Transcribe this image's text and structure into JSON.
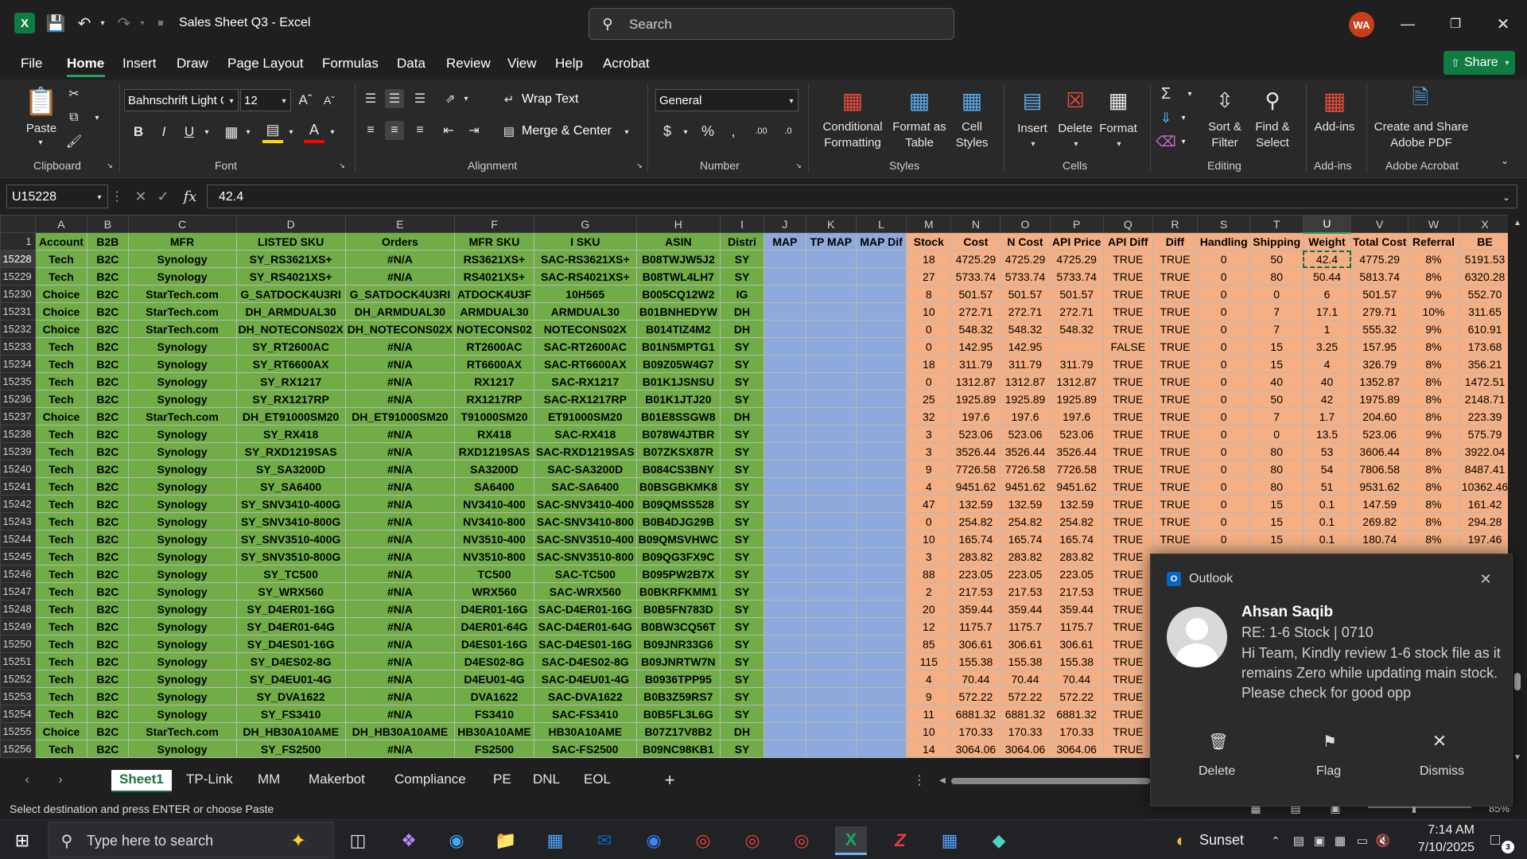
{
  "app": {
    "title": "Sales Sheet Q3 - Excel",
    "search_placeholder": "Search",
    "avatar": "WA",
    "share": "Share"
  },
  "menu": [
    "File",
    "Home",
    "Insert",
    "Draw",
    "Page Layout",
    "Formulas",
    "Data",
    "Review",
    "View",
    "Help",
    "Acrobat"
  ],
  "ribbon": {
    "paste": "Paste",
    "clipboard": "Clipboard",
    "font_name": "Bahnschrift Light C",
    "font_size": "12",
    "font": "Font",
    "wrap": "Wrap Text",
    "merge": "Merge & Center",
    "alignment": "Alignment",
    "number_format": "General",
    "number": "Number",
    "cond1": "Conditional",
    "cond2": "Formatting",
    "fat1": "Format as",
    "fat2": "Table",
    "cs1": "Cell",
    "cs2": "Styles",
    "styles": "Styles",
    "insert": "Insert",
    "delete": "Delete",
    "format": "Format",
    "cells": "Cells",
    "sort1": "Sort &",
    "sort2": "Filter",
    "find1": "Find &",
    "find2": "Select",
    "editing": "Editing",
    "addins": "Add-ins",
    "addins_grp": "Add-ins",
    "acro1": "Create and Share",
    "acro2": "Adobe PDF",
    "acrobat_grp": "Adobe Acrobat"
  },
  "formula_bar": {
    "name_box": "U15228",
    "value": "42.4"
  },
  "columns": [
    "A",
    "B",
    "C",
    "D",
    "E",
    "F",
    "G",
    "H",
    "I",
    "J",
    "K",
    "L",
    "M",
    "N",
    "O",
    "P",
    "Q",
    "R",
    "S",
    "T",
    "U",
    "V",
    "W",
    "X",
    "M"
  ],
  "header_row": {
    "num": "1",
    "cells": [
      "Account",
      "B2B",
      "MFR",
      "LISTED SKU",
      "Orders",
      "MFR SKU",
      "I SKU",
      "ASIN",
      "Distri",
      "MAP",
      "TP MAP",
      "MAP Dif",
      "Stock",
      "Cost",
      "N Cost",
      "API Price",
      "API Diff",
      "Diff",
      "Handling",
      "Shipping",
      "Weight",
      "Total Cost",
      "Referral",
      "BE",
      ""
    ]
  },
  "rows": [
    [
      "15228",
      "Tech",
      "B2C",
      "Synology",
      "SY_RS3621XS+",
      "#N/A",
      "RS3621XS+",
      "SAC-RS3621XS+",
      "B08TWJW5J2",
      "SY",
      "",
      "",
      "",
      "18",
      "4725.29",
      "4725.29",
      "4725.29",
      "TRUE",
      "TRUE",
      "0",
      "50",
      "42.4",
      "4775.29",
      "8%",
      "5191.53",
      ""
    ],
    [
      "15229",
      "Tech",
      "B2C",
      "Synology",
      "SY_RS4021XS+",
      "#N/A",
      "RS4021XS+",
      "SAC-RS4021XS+",
      "B08TWL4LH7",
      "SY",
      "",
      "",
      "",
      "27",
      "5733.74",
      "5733.74",
      "5733.74",
      "TRUE",
      "TRUE",
      "0",
      "80",
      "50.44",
      "5813.74",
      "8%",
      "6320.28",
      ""
    ],
    [
      "15230",
      "Choice",
      "B2C",
      "StarTech.com",
      "G_SATDOCK4U3RI",
      "G_SATDOCK4U3RI",
      "ATDOCK4U3F",
      "10H565",
      "B005CQ12W2",
      "IG",
      "",
      "",
      "",
      "8",
      "501.57",
      "501.57",
      "501.57",
      "TRUE",
      "TRUE",
      "0",
      "0",
      "6",
      "501.57",
      "9%",
      "552.70",
      ""
    ],
    [
      "15231",
      "Choice",
      "B2C",
      "StarTech.com",
      "DH_ARMDUAL30",
      "DH_ARMDUAL30",
      "ARMDUAL30",
      "ARMDUAL30",
      "B01BNHEDYW",
      "DH",
      "",
      "",
      "",
      "10",
      "272.71",
      "272.71",
      "272.71",
      "TRUE",
      "TRUE",
      "0",
      "7",
      "17.1",
      "279.71",
      "10%",
      "311.65",
      ""
    ],
    [
      "15232",
      "Choice",
      "B2C",
      "StarTech.com",
      "DH_NOTECONS02X",
      "DH_NOTECONS02X",
      "NOTECONS02",
      "NOTECONS02X",
      "B014TIZ4M2",
      "DH",
      "",
      "",
      "",
      "0",
      "548.32",
      "548.32",
      "548.32",
      "TRUE",
      "TRUE",
      "0",
      "7",
      "1",
      "555.32",
      "9%",
      "610.91",
      ""
    ],
    [
      "15233",
      "Tech",
      "B2C",
      "Synology",
      "SY_RT2600AC",
      "#N/A",
      "RT2600AC",
      "SAC-RT2600AC",
      "B01N5MPTG1",
      "SY",
      "",
      "",
      "",
      "0",
      "142.95",
      "142.95",
      "",
      "FALSE",
      "TRUE",
      "0",
      "15",
      "3.25",
      "157.95",
      "8%",
      "173.68",
      ""
    ],
    [
      "15234",
      "Tech",
      "B2C",
      "Synology",
      "SY_RT6600AX",
      "#N/A",
      "RT6600AX",
      "SAC-RT6600AX",
      "B09Z05W4G7",
      "SY",
      "",
      "",
      "",
      "18",
      "311.79",
      "311.79",
      "311.79",
      "TRUE",
      "TRUE",
      "0",
      "15",
      "4",
      "326.79",
      "8%",
      "356.21",
      ""
    ],
    [
      "15235",
      "Tech",
      "B2C",
      "Synology",
      "SY_RX1217",
      "#N/A",
      "RX1217",
      "SAC-RX1217",
      "B01K1JSNSU",
      "SY",
      "",
      "",
      "",
      "0",
      "1312.87",
      "1312.87",
      "1312.87",
      "TRUE",
      "TRUE",
      "0",
      "40",
      "40",
      "1352.87",
      "8%",
      "1472.51",
      ""
    ],
    [
      "15236",
      "Tech",
      "B2C",
      "Synology",
      "SY_RX1217RP",
      "#N/A",
      "RX1217RP",
      "SAC-RX1217RP",
      "B01K1JTJ20",
      "SY",
      "",
      "",
      "",
      "25",
      "1925.89",
      "1925.89",
      "1925.89",
      "TRUE",
      "TRUE",
      "0",
      "50",
      "42",
      "1975.89",
      "8%",
      "2148.71",
      ""
    ],
    [
      "15237",
      "Choice",
      "B2C",
      "StarTech.com",
      "DH_ET91000SM20",
      "DH_ET91000SM20",
      "T91000SM20",
      "ET91000SM20",
      "B01E8SSGW8",
      "DH",
      "",
      "",
      "",
      "32",
      "197.6",
      "197.6",
      "197.6",
      "TRUE",
      "TRUE",
      "0",
      "7",
      "1.7",
      "204.60",
      "8%",
      "223.39",
      ""
    ],
    [
      "15238",
      "Tech",
      "B2C",
      "Synology",
      "SY_RX418",
      "#N/A",
      "RX418",
      "SAC-RX418",
      "B078W4JTBR",
      "SY",
      "",
      "",
      "",
      "3",
      "523.06",
      "523.06",
      "523.06",
      "TRUE",
      "TRUE",
      "0",
      "0",
      "13.5",
      "523.06",
      "9%",
      "575.79",
      ""
    ],
    [
      "15239",
      "Tech",
      "B2C",
      "Synology",
      "SY_RXD1219SAS",
      "#N/A",
      "RXD1219SAS",
      "SAC-RXD1219SAS",
      "B07ZKSX87R",
      "SY",
      "",
      "",
      "",
      "3",
      "3526.44",
      "3526.44",
      "3526.44",
      "TRUE",
      "TRUE",
      "0",
      "80",
      "53",
      "3606.44",
      "8%",
      "3922.04",
      ""
    ],
    [
      "15240",
      "Tech",
      "B2C",
      "Synology",
      "SY_SA3200D",
      "#N/A",
      "SA3200D",
      "SAC-SA3200D",
      "B084CS3BNY",
      "SY",
      "",
      "",
      "",
      "9",
      "7726.58",
      "7726.58",
      "7726.58",
      "TRUE",
      "TRUE",
      "0",
      "80",
      "54",
      "7806.58",
      "8%",
      "8487.41",
      ""
    ],
    [
      "15241",
      "Tech",
      "B2C",
      "Synology",
      "SY_SA6400",
      "#N/A",
      "SA6400",
      "SAC-SA6400",
      "B0BSGBKMK8",
      "SY",
      "",
      "",
      "",
      "4",
      "9451.62",
      "9451.62",
      "9451.62",
      "TRUE",
      "TRUE",
      "0",
      "80",
      "51",
      "9531.62",
      "8%",
      "10362.46",
      ""
    ],
    [
      "15242",
      "Tech",
      "B2C",
      "Synology",
      "SY_SNV3410-400G",
      "#N/A",
      "NV3410-400",
      "SAC-SNV3410-400",
      "B09QMSS528",
      "SY",
      "",
      "",
      "",
      "47",
      "132.59",
      "132.59",
      "132.59",
      "TRUE",
      "TRUE",
      "0",
      "15",
      "0.1",
      "147.59",
      "8%",
      "161.42",
      ""
    ],
    [
      "15243",
      "Tech",
      "B2C",
      "Synology",
      "SY_SNV3410-800G",
      "#N/A",
      "NV3410-800",
      "SAC-SNV3410-800",
      "B0B4DJG29B",
      "SY",
      "",
      "",
      "",
      "0",
      "254.82",
      "254.82",
      "254.82",
      "TRUE",
      "TRUE",
      "0",
      "15",
      "0.1",
      "269.82",
      "8%",
      "294.28",
      ""
    ],
    [
      "15244",
      "Tech",
      "B2C",
      "Synology",
      "SY_SNV3510-400G",
      "#N/A",
      "NV3510-400",
      "SAC-SNV3510-400",
      "B09QMSVHWC",
      "SY",
      "",
      "",
      "",
      "10",
      "165.74",
      "165.74",
      "165.74",
      "TRUE",
      "TRUE",
      "0",
      "15",
      "0.1",
      "180.74",
      "8%",
      "197.46",
      ""
    ],
    [
      "15245",
      "Tech",
      "B2C",
      "Synology",
      "SY_SNV3510-800G",
      "#N/A",
      "NV3510-800",
      "SAC-SNV3510-800",
      "B09QG3FX9C",
      "SY",
      "",
      "",
      "",
      "3",
      "283.82",
      "283.82",
      "283.82",
      "TRUE",
      "",
      "",
      "",
      "",
      "",
      "",
      "",
      ""
    ],
    [
      "15246",
      "Tech",
      "B2C",
      "Synology",
      "SY_TC500",
      "#N/A",
      "TC500",
      "SAC-TC500",
      "B095PW2B7X",
      "SY",
      "",
      "",
      "",
      "88",
      "223.05",
      "223.05",
      "223.05",
      "TRUE",
      "",
      "",
      "",
      "",
      "",
      "",
      "",
      ""
    ],
    [
      "15247",
      "Tech",
      "B2C",
      "Synology",
      "SY_WRX560",
      "#N/A",
      "WRX560",
      "SAC-WRX560",
      "B0BKRFKMM1",
      "SY",
      "",
      "",
      "",
      "2",
      "217.53",
      "217.53",
      "217.53",
      "TRUE",
      "",
      "",
      "",
      "",
      "",
      "",
      "",
      ""
    ],
    [
      "15248",
      "Tech",
      "B2C",
      "Synology",
      "SY_D4ER01-16G",
      "#N/A",
      "D4ER01-16G",
      "SAC-D4ER01-16G",
      "B0B5FN783D",
      "SY",
      "",
      "",
      "",
      "20",
      "359.44",
      "359.44",
      "359.44",
      "TRUE",
      "",
      "",
      "",
      "",
      "",
      "",
      "",
      ""
    ],
    [
      "15249",
      "Tech",
      "B2C",
      "Synology",
      "SY_D4ER01-64G",
      "#N/A",
      "D4ER01-64G",
      "SAC-D4ER01-64G",
      "B0BW3CQ56T",
      "SY",
      "",
      "",
      "",
      "12",
      "1175.7",
      "1175.7",
      "1175.7",
      "TRUE",
      "",
      "",
      "",
      "",
      "",
      "",
      "",
      ""
    ],
    [
      "15250",
      "Tech",
      "B2C",
      "Synology",
      "SY_D4ES01-16G",
      "#N/A",
      "D4ES01-16G",
      "SAC-D4ES01-16G",
      "B09JNR33G6",
      "SY",
      "",
      "",
      "",
      "85",
      "306.61",
      "306.61",
      "306.61",
      "TRUE",
      "",
      "",
      "",
      "",
      "",
      "",
      "",
      ""
    ],
    [
      "15251",
      "Tech",
      "B2C",
      "Synology",
      "SY_D4ES02-8G",
      "#N/A",
      "D4ES02-8G",
      "SAC-D4ES02-8G",
      "B09JNRTW7N",
      "SY",
      "",
      "",
      "",
      "115",
      "155.38",
      "155.38",
      "155.38",
      "TRUE",
      "",
      "",
      "",
      "",
      "",
      "",
      "",
      ""
    ],
    [
      "15252",
      "Tech",
      "B2C",
      "Synology",
      "SY_D4EU01-4G",
      "#N/A",
      "D4EU01-4G",
      "SAC-D4EU01-4G",
      "B0936TPP95",
      "SY",
      "",
      "",
      "",
      "4",
      "70.44",
      "70.44",
      "70.44",
      "TRUE",
      "",
      "",
      "",
      "",
      "",
      "",
      "",
      ""
    ],
    [
      "15253",
      "Tech",
      "B2C",
      "Synology",
      "SY_DVA1622",
      "#N/A",
      "DVA1622",
      "SAC-DVA1622",
      "B0B3Z59RS7",
      "SY",
      "",
      "",
      "",
      "9",
      "572.22",
      "572.22",
      "572.22",
      "TRUE",
      "",
      "",
      "",
      "",
      "",
      "",
      "",
      ""
    ],
    [
      "15254",
      "Tech",
      "B2C",
      "Synology",
      "SY_FS3410",
      "#N/A",
      "FS3410",
      "SAC-FS3410",
      "B0B5FL3L6G",
      "SY",
      "",
      "",
      "",
      "11",
      "6881.32",
      "6881.32",
      "6881.32",
      "TRUE",
      "",
      "",
      "",
      "",
      "",
      "",
      "",
      ""
    ],
    [
      "15255",
      "Choice",
      "B2C",
      "StarTech.com",
      "DH_HB30A10AME",
      "DH_HB30A10AME",
      "HB30A10AME",
      "HB30A10AME",
      "B07Z17V8B2",
      "DH",
      "",
      "",
      "",
      "10",
      "170.33",
      "170.33",
      "170.33",
      "TRUE",
      "",
      "",
      "",
      "",
      "",
      "",
      "",
      ""
    ],
    [
      "15256",
      "Tech",
      "B2C",
      "Synology",
      "SY_FS2500",
      "#N/A",
      "FS2500",
      "SAC-FS2500",
      "B09NC98KB1",
      "SY",
      "",
      "",
      "",
      "14",
      "3064.06",
      "3064.06",
      "3064.06",
      "TRUE",
      "",
      "",
      "",
      "",
      "",
      "",
      "",
      ""
    ]
  ],
  "sheets": [
    "Sheet1",
    "TP-Link",
    "MM",
    "Makerbot",
    "Compliance",
    "PE",
    "DNL",
    "EOL"
  ],
  "status": "Select destination and press ENTER or choose Paste",
  "zoom": "85%",
  "toast": {
    "app": "Outlook",
    "sender": "Ahsan Saqib",
    "subject": "RE: 1-6 Stock | 0710",
    "body": "Hi Team,  Kindly review 1-6 stock file as it remains Zero while updating main stock.  Please check for good opp",
    "delete": "Delete",
    "flag": "Flag",
    "dismiss": "Dismiss"
  },
  "taskbar": {
    "search": "Type here to search",
    "weather": "Sunset",
    "time": "7:14 AM",
    "date": "7/10/2025",
    "notif_count": "3"
  },
  "colors": {
    "green": "#70ad47",
    "blue": "#8ea9db",
    "orange": "#f4b084",
    "excel": "#107c41"
  }
}
